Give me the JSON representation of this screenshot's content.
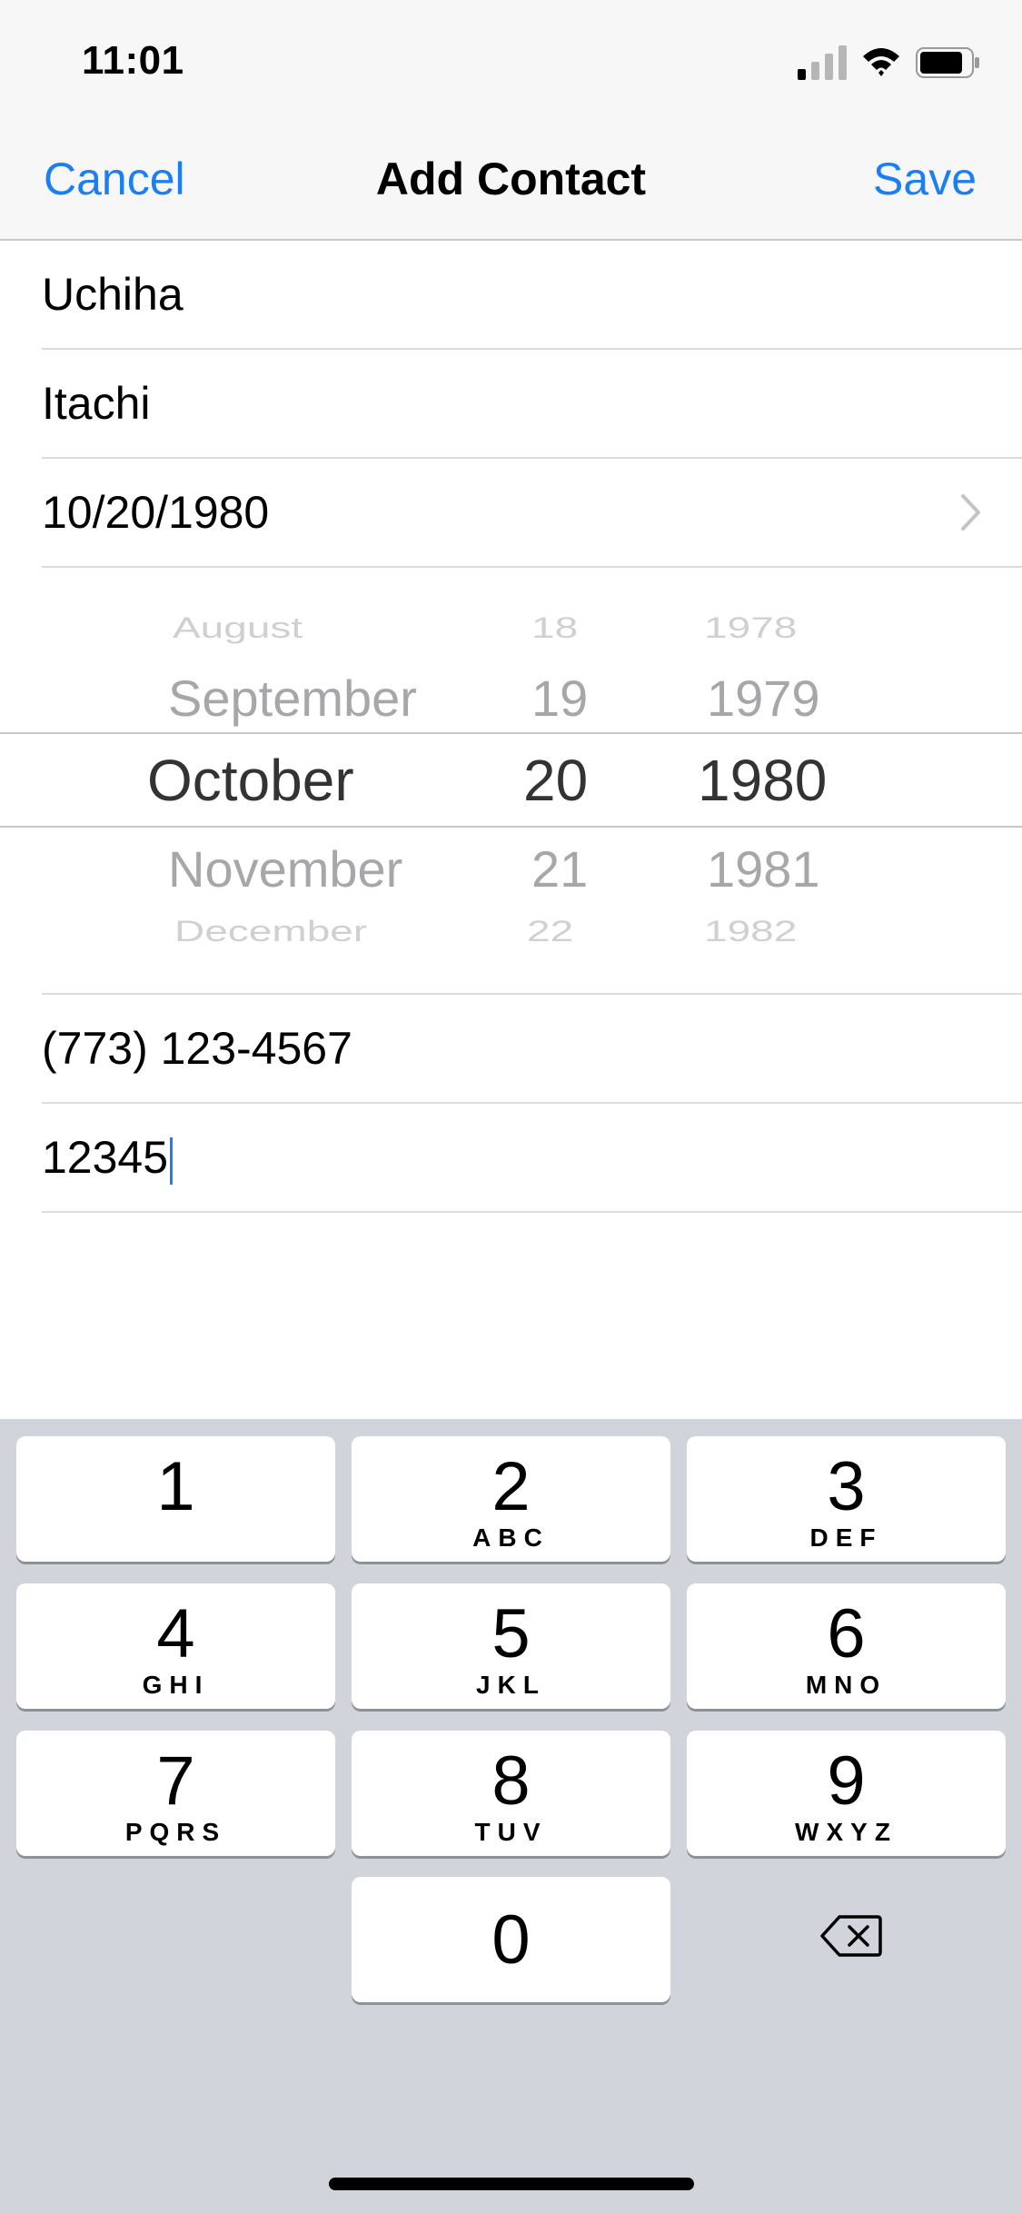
{
  "status_bar": {
    "time": "11:01"
  },
  "nav": {
    "cancel": "Cancel",
    "title": "Add Contact",
    "save": "Save"
  },
  "fields": {
    "last_name": "Uchiha",
    "first_name": "Itachi",
    "birthday": "10/20/1980",
    "phone": "(773) 123-4567",
    "zip": "12345"
  },
  "picker": {
    "months": [
      "August",
      "September",
      "October",
      "November",
      "December"
    ],
    "days": [
      "18",
      "19",
      "20",
      "21",
      "22"
    ],
    "years": [
      "1978",
      "1979",
      "1980",
      "1981",
      "1982"
    ],
    "selected": {
      "month": "October",
      "day": "20",
      "year": "1980"
    }
  },
  "keyboard": {
    "keys": [
      {
        "num": "1",
        "letters": ""
      },
      {
        "num": "2",
        "letters": "ABC"
      },
      {
        "num": "3",
        "letters": "DEF"
      },
      {
        "num": "4",
        "letters": "GHI"
      },
      {
        "num": "5",
        "letters": "JKL"
      },
      {
        "num": "6",
        "letters": "MNO"
      },
      {
        "num": "7",
        "letters": "PQRS"
      },
      {
        "num": "8",
        "letters": "TUV"
      },
      {
        "num": "9",
        "letters": "WXYZ"
      },
      {
        "num": "0",
        "letters": ""
      }
    ]
  },
  "colors": {
    "accent": "#1a7ff4",
    "keyboard_bg": "#d1d4da"
  }
}
